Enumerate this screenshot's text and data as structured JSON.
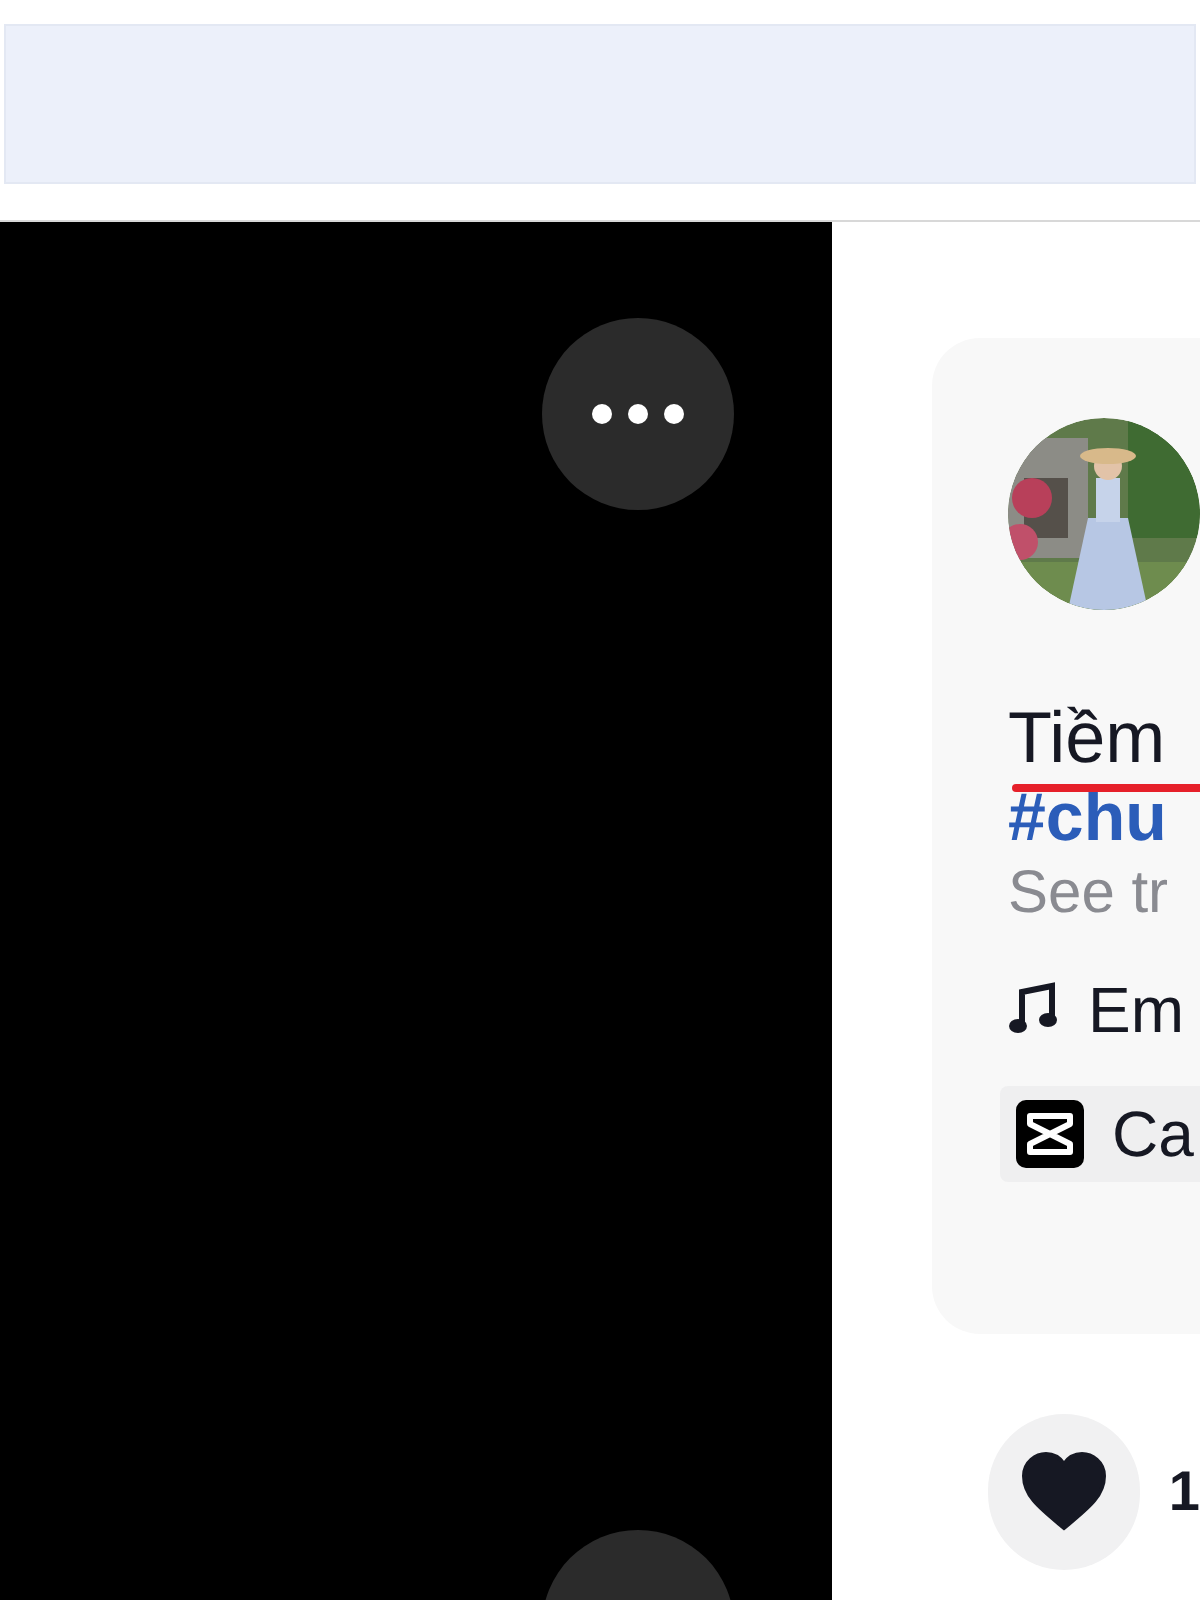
{
  "post": {
    "title": "Tiềm",
    "title_underlined": true,
    "hashtag": "#chu",
    "translation_link": "See tr",
    "music": "Em",
    "template": "Ca"
  },
  "actions": [
    {
      "kind": "like",
      "count": "1",
      "selected": true
    }
  ]
}
